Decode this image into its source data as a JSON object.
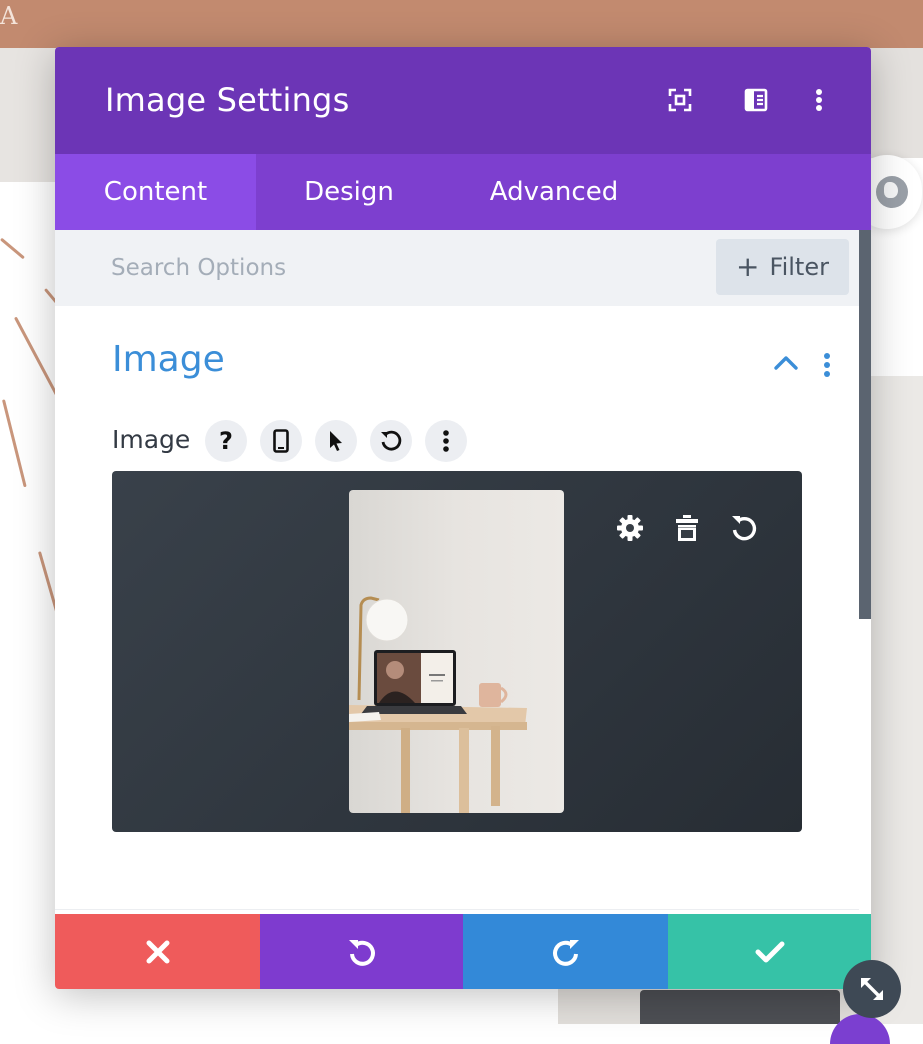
{
  "background": {
    "top_letter": "A"
  },
  "modal": {
    "title": "Image Settings",
    "header_icons": [
      "expand-icon",
      "split-view-icon",
      "more-vertical-icon"
    ],
    "tabs": [
      {
        "label": "Content",
        "active": true
      },
      {
        "label": "Design",
        "active": false
      },
      {
        "label": "Advanced",
        "active": false
      }
    ],
    "search": {
      "placeholder": "Search Options",
      "value": ""
    },
    "filter_label": "Filter",
    "section": {
      "title": "Image",
      "expanded": true
    },
    "field": {
      "label": "Image",
      "buttons": [
        "help-icon",
        "mobile-icon",
        "cursor-icon",
        "reset-icon",
        "more-vertical-icon"
      ]
    },
    "preview_actions": [
      "gear-icon",
      "trash-icon",
      "undo-icon"
    ],
    "footer": [
      {
        "name": "cancel",
        "icon": "close-icon",
        "color": "#ef5b5b"
      },
      {
        "name": "undo",
        "icon": "undo-icon",
        "color": "#7e3bcf"
      },
      {
        "name": "redo",
        "icon": "redo-icon",
        "color": "#3389d8"
      },
      {
        "name": "save",
        "icon": "check-icon",
        "color": "#36c2a7"
      }
    ]
  },
  "colors": {
    "header": "#6c35b6",
    "tabs": "#7d3fcf",
    "active_tab": "#8b4ce6",
    "section_title": "#3b8ed8"
  }
}
